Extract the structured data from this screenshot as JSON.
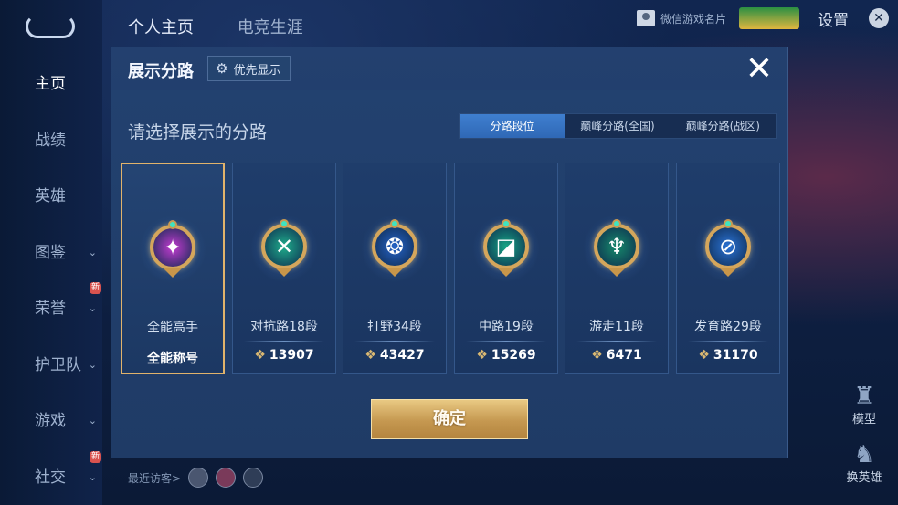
{
  "app": {
    "top_tabs": [
      "个人主页",
      "电竞生涯"
    ],
    "wechat_card": "微信游戏名片",
    "settings": "设置",
    "nav": [
      {
        "label": "主页",
        "active": true,
        "chevron": false,
        "new": false
      },
      {
        "label": "战绩",
        "active": false,
        "chevron": false,
        "new": false
      },
      {
        "label": "英雄",
        "active": false,
        "chevron": false,
        "new": false
      },
      {
        "label": "图鉴",
        "active": false,
        "chevron": true,
        "new": false
      },
      {
        "label": "荣誉",
        "active": false,
        "chevron": true,
        "new": true
      },
      {
        "label": "护卫队",
        "active": false,
        "chevron": true,
        "new": false
      },
      {
        "label": "游戏",
        "active": false,
        "chevron": true,
        "new": false
      },
      {
        "label": "社交",
        "active": false,
        "chevron": true,
        "new": true
      }
    ],
    "new_badge": "新",
    "visitors_label": "最近访客>",
    "side_buttons": {
      "model": "模型",
      "switch_hero": "换英雄"
    }
  },
  "modal": {
    "title": "展示分路",
    "priority_label": "优先显示",
    "close_icon": "close-icon",
    "prompt": "请选择展示的分路",
    "segments": [
      {
        "label": "分路段位",
        "active": true
      },
      {
        "label": "巅峰分路(全国)",
        "active": false
      },
      {
        "label": "巅峰分路(战区)",
        "active": false
      }
    ],
    "cards": [
      {
        "name": "全能高手",
        "stat": "全能称号",
        "selected": true,
        "show_peak_icon": false,
        "badge_color": "#c23bd0",
        "badge_glyph": "✦"
      },
      {
        "name": "对抗路18段",
        "stat": "13907",
        "selected": false,
        "show_peak_icon": true,
        "badge_color": "#1fae8c",
        "badge_glyph": "✕"
      },
      {
        "name": "打野34段",
        "stat": "43427",
        "selected": false,
        "show_peak_icon": true,
        "badge_color": "#2563c7",
        "badge_glyph": "❂"
      },
      {
        "name": "中路19段",
        "stat": "15269",
        "selected": false,
        "show_peak_icon": true,
        "badge_color": "#16a584",
        "badge_glyph": "◪"
      },
      {
        "name": "游走11段",
        "stat": "6471",
        "selected": false,
        "show_peak_icon": true,
        "badge_color": "#168a6b",
        "badge_glyph": "♆"
      },
      {
        "name": "发育路29段",
        "stat": "31170",
        "selected": false,
        "show_peak_icon": true,
        "badge_color": "#2a73d6",
        "badge_glyph": "⊘"
      }
    ],
    "confirm_label": "确定"
  }
}
